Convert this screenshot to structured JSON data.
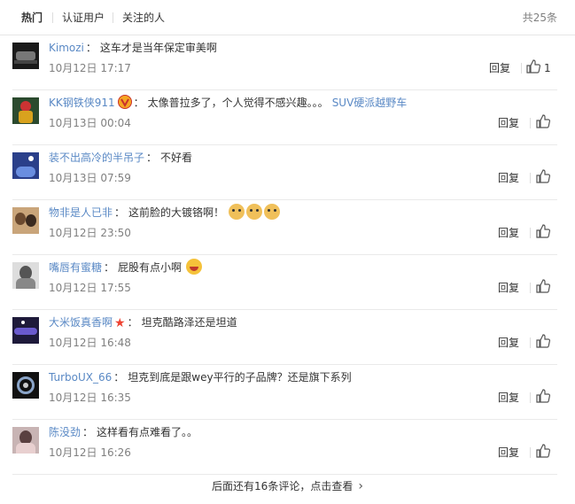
{
  "tabs": {
    "hot": "热门",
    "verified": "认证用户",
    "following": "关注的人"
  },
  "total": "共25条",
  "reply_label": "回复",
  "more_label": "后面还有16条评论，点击查看",
  "comments": [
    {
      "user": "Kimozi",
      "text": "这车才是当年保定审美啊",
      "time": "10月12日 17:17",
      "likes": "1"
    },
    {
      "user": "KK钢铁侠911",
      "text": "太像普拉多了，个人觉得不感兴趣。。。",
      "topic": "SUV硬派越野车",
      "time": "10月13日 00:04",
      "likes": ""
    },
    {
      "user": "装不出高冷的半吊子",
      "text": "不好看",
      "time": "10月13日 07:59",
      "likes": ""
    },
    {
      "user": "物非是人已非",
      "text": "这前脸的大镀铬啊！",
      "time": "10月12日 23:50",
      "likes": ""
    },
    {
      "user": "嘴唇有蜜糖",
      "text": "屁股有点小啊",
      "time": "10月12日 17:55",
      "likes": ""
    },
    {
      "user": "大米饭真香啊",
      "text": "坦克酷路泽还是坦道",
      "time": "10月12日 16:48",
      "likes": ""
    },
    {
      "user": "TurboUX_66",
      "text": "坦克到底是跟wey平行的子品牌？还是旗下系列",
      "time": "10月12日 16:35",
      "likes": ""
    },
    {
      "user": "陈没劲",
      "text": "这样看有点难看了。。",
      "time": "10月12日 16:26",
      "likes": ""
    }
  ],
  "colors": {
    "link": "#5a89c5",
    "badge": "#f5a623",
    "star": "#e43"
  },
  "icons": {
    "like": "thumbs-up-icon",
    "more": "chevron-right-icon",
    "badge": "vip-badge-icon",
    "emoji": "doge-emoji-icon"
  }
}
